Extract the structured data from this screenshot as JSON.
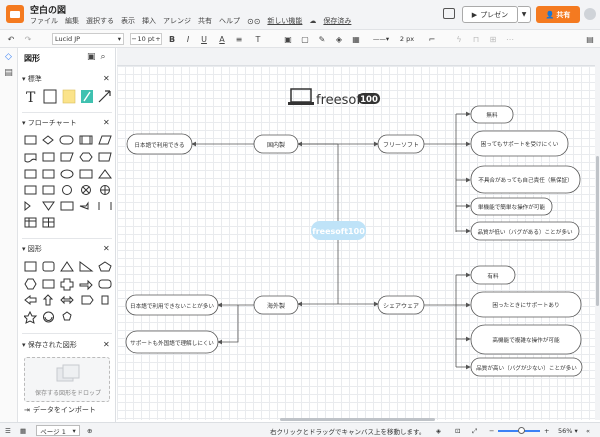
{
  "app": {
    "doc_title": "空白の図",
    "menu": [
      "ファイル",
      "編集",
      "選択する",
      "表示",
      "挿入",
      "アレンジ",
      "共有",
      "ヘルプ"
    ],
    "new_feature_link": "新しい機能",
    "saved_status": "保存済み",
    "present_label": "プレゼン",
    "share_label": "共有"
  },
  "toolbar": {
    "font": "Lucid JP",
    "font_size": "10 pt",
    "line_width": "2 px"
  },
  "panel": {
    "title": "図形",
    "sections": {
      "standard": "標準",
      "flowchart": "フローチャート",
      "shapes": "図形",
      "saved": "保存された図形"
    },
    "drop_text": "保存する図形をドロップ",
    "import_label": "データをインポート"
  },
  "diagram": {
    "logo_text": "freesoft",
    "logo_badge": "100",
    "center": "freesoft100",
    "domestic": "国内製",
    "overseas": "海外製",
    "free": "フリーソフト",
    "share": "シェアウェア",
    "domestic_leaf": "日本語で利用できる",
    "overseas_leaves": [
      "日本語で利用できないことが多い",
      "サポートも外国語で理解しにくい"
    ],
    "free_leaves": [
      "無料",
      "困ってもサポートを受けにくい",
      "不具合があっても自己責任（無保証）",
      "単機能で簡単な操作が可能",
      "品質が低い（バグがある）ことが多い"
    ],
    "share_leaves": [
      "有料",
      "困ったときにサポートあり",
      "高機能で複雑な操作が可能",
      "品質が高い（バグが少ない）ことが多い"
    ]
  },
  "statusbar": {
    "page": "ページ 1",
    "hint": "右クリックとドラッグでキャンバス上を移動します。",
    "zoom": "56%"
  },
  "colors": {
    "accent": "#f47a20",
    "center_node": "#bfe3f8"
  }
}
